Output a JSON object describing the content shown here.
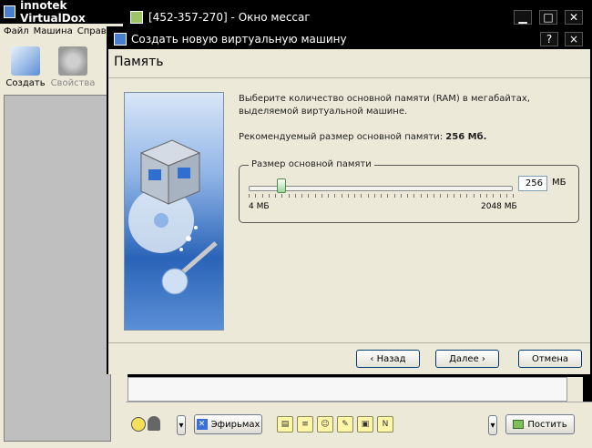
{
  "vbox": {
    "title": "innotek VirtualDox",
    "menu": [
      "Файл",
      "Машина",
      "Справ"
    ],
    "toolbar": {
      "create": "Создать",
      "properties": "Свойства"
    }
  },
  "chat": {
    "title": "[452-357-270] - Окно мессаг",
    "smileys_label": "Эфирьмах",
    "post_label": "Постить"
  },
  "dialog": {
    "title": "Создать новую виртуальную машину",
    "help": "?",
    "close": "×",
    "page_title": "Память",
    "description": "Выберите количество основной памяти (RAM) в мегабайтах, выделяемой виртуальной машине.",
    "recommended_prefix": "Рекомендуемый размер основной памяти: ",
    "recommended_value": "256 Мб.",
    "group_label": "Размер основной памяти",
    "memory_value": "256",
    "memory_unit": "МБ",
    "min_label": "4 МБ",
    "max_label": "2048 МБ",
    "memory_fraction": 0.123,
    "buttons": {
      "back": "‹ Назад",
      "next": "Далее ›",
      "cancel": "Отмена"
    }
  }
}
